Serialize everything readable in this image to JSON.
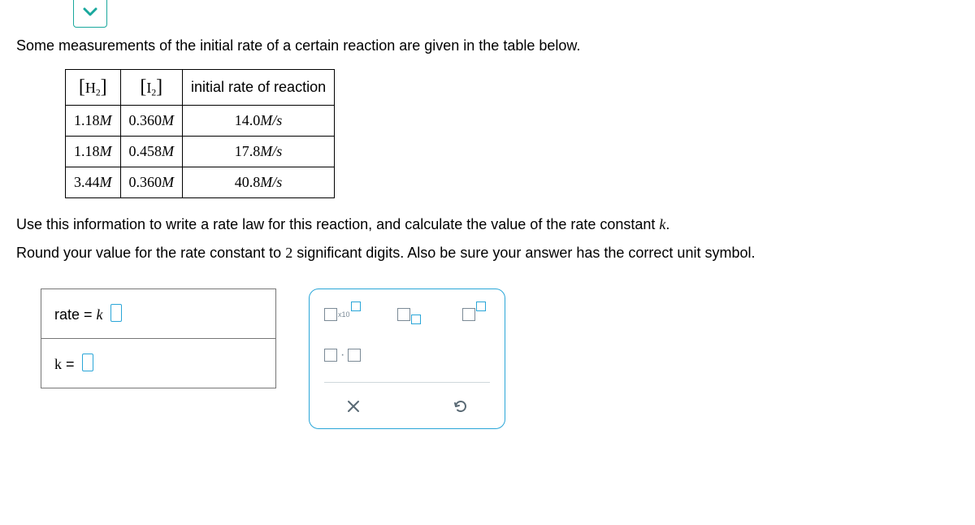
{
  "chevron_color": "#19a89d",
  "intro": "Some measurements of the initial rate of a certain reaction are given in the table below.",
  "table": {
    "headers": {
      "h2": "H",
      "h2_sub": "2",
      "i2": "I",
      "i2_sub": "2",
      "rate": "initial rate of reaction"
    },
    "rows": [
      {
        "h2": "1.18",
        "h2_unit": "M",
        "i2": "0.360",
        "i2_unit": "M",
        "rate": "14.0",
        "rate_unit": "M/s"
      },
      {
        "h2": "1.18",
        "h2_unit": "M",
        "i2": "0.458",
        "i2_unit": "M",
        "rate": "17.8",
        "rate_unit": "M/s"
      },
      {
        "h2": "3.44",
        "h2_unit": "M",
        "i2": "0.360",
        "i2_unit": "M",
        "rate": "40.8",
        "rate_unit": "M/s"
      }
    ]
  },
  "instruction1": "Use this information to write a rate law for this reaction, and calculate the value of the rate constant ",
  "instruction1_var": "k",
  "instruction1_end": ".",
  "instruction2_a": "Round your value for the rate constant to ",
  "instruction2_num": "2",
  "instruction2_b": " significant digits. Also be sure your answer has the correct unit symbol.",
  "answer": {
    "rate_label_a": "rate",
    "rate_label_b": " = ",
    "rate_label_c": "k",
    "k_label_a": "k",
    "k_label_b": " = "
  },
  "tools": {
    "x10_text": "x10"
  }
}
